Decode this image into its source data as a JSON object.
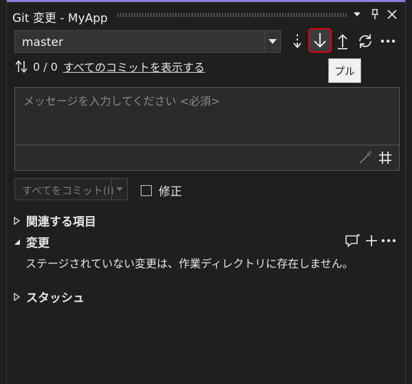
{
  "window": {
    "title": "Git 変更 - MyApp"
  },
  "branch": {
    "name": "master"
  },
  "toolbar": {
    "tooltip": "プル"
  },
  "commits": {
    "count": "0 / 0",
    "view_all_link": "すべてのコミットを表示する"
  },
  "message": {
    "placeholder": "メッセージを入力してください <必須>"
  },
  "commit": {
    "button_label": "すべてをコミット(I)",
    "amend_label": "修正"
  },
  "sections": {
    "related": "関連する項目",
    "changes": "変更",
    "changes_empty": "ステージされていない変更は、作業ディレクトリに存在しません。",
    "stash": "スタッシュ"
  },
  "colors": {
    "accent": "#8e7cdb",
    "highlight": "#e0000f",
    "background": "#1f1f1f"
  }
}
